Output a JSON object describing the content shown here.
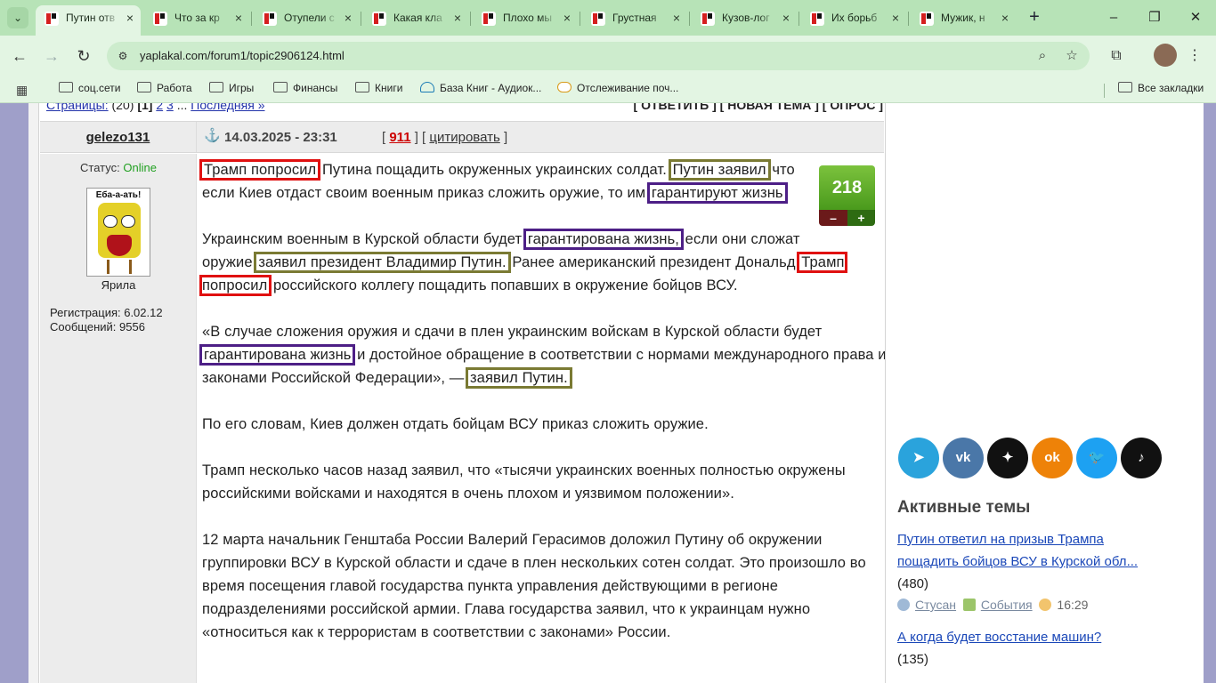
{
  "browser": {
    "tabs": [
      {
        "title": "Путин отв",
        "active": true
      },
      {
        "title": "Что за кр"
      },
      {
        "title": "Отупели с"
      },
      {
        "title": "Какая кла"
      },
      {
        "title": "Плохо мы"
      },
      {
        "title": "Грустная"
      },
      {
        "title": "Кузов-лог"
      },
      {
        "title": "Их борьб"
      },
      {
        "title": "Мужик, н"
      }
    ],
    "new_tab": "+",
    "url": "yaplakal.com/forum1/topic2906124.html",
    "bookmarks": [
      "соц.сети",
      "Работа",
      "Игры",
      "Финансы",
      "Книги",
      "База Книг - Аудиок...",
      "Отслеживание поч...",
      "Все закладки"
    ]
  },
  "topbar": {
    "pages_label": "Страницы:",
    "pages_count": "(20)",
    "current_page": "[1]",
    "page_links": [
      "2",
      "3"
    ],
    "last_label": "Последняя »",
    "actions": "[ ОТВЕТИТЬ ] [ НОВАЯ ТЕМА ] [ ОПРОС ]"
  },
  "post": {
    "author": "gelezo131",
    "date": "14.03.2025 - 23:31",
    "reply_count": "911",
    "cite_label": "цитировать",
    "status_label": "Статус:",
    "status_value": "Online",
    "avatar_text": "Еба-а-ать!",
    "avatar_caption": "Ярила",
    "registration": "Регистрация: 6.02.12",
    "messages": "Сообщений: 9556",
    "rating": "218",
    "rating_minus": "–",
    "rating_plus": "+",
    "p1": {
      "a": "Трамп попросил",
      "b": " Путина пощадить окруженных украинских солдат. ",
      "c": "Путин заявил",
      "d": " что если Киев отдаст своим военным приказ сложить оружие, то им ",
      "e": "гарантируют жизнь"
    },
    "p2": {
      "a": "Украинским военным в Курской области будет ",
      "b": "гарантирована жизнь,",
      "c": " если они сложат оружие,",
      "d": "заявил президент Владимир Путин.",
      "e": " Ранее американский президент Дональд ",
      "f": "Трамп попросил",
      "g": " российского коллегу пощадить попавших в окружение бойцов ВСУ."
    },
    "p3": {
      "a": "«В случае сложения оружия и сдачи в плен украинским войскам в Курской области будет ",
      "b": "гарантирована жизнь",
      "c": " и достойное обращение в соответствии с нормами международного права и законами Российской Федерации», — ",
      "d": "заявил Путин."
    },
    "p4": "По его словам, Киев должен отдать бойцам ВСУ приказ сложить оружие.",
    "p5": "Трамп несколько часов назад заявил, что «тысячи украинских военных полностью окружены российскими войсками и находятся в очень плохом и уязвимом положении».",
    "p6": "12 марта начальник Генштаба России Валерий Герасимов доложил Путину об окружении группировки ВСУ в Курской области и сдаче в плен нескольких сотен солдат. Это произошло во время посещения главой государства пункта управления действующими в регионе подразделениями российской армии. Глава государства заявил, что к украинцам нужно «относиться как к террористам в соответствии с законами» России."
  },
  "sidebar": {
    "social": [
      "telegram-icon",
      "vk-icon",
      "zen-icon",
      "ok-icon",
      "twitter-icon",
      "tiktok-icon"
    ],
    "active_title": "Активные темы",
    "topics": [
      {
        "title": "Путин ответил на призыв Трампа пощадить бойцов ВСУ в Курской обл...",
        "count": "(480)",
        "user": "Стусан",
        "section": "События",
        "time": "16:29"
      },
      {
        "title": "А когда будет восстание машин?",
        "count": "(135)"
      }
    ]
  }
}
